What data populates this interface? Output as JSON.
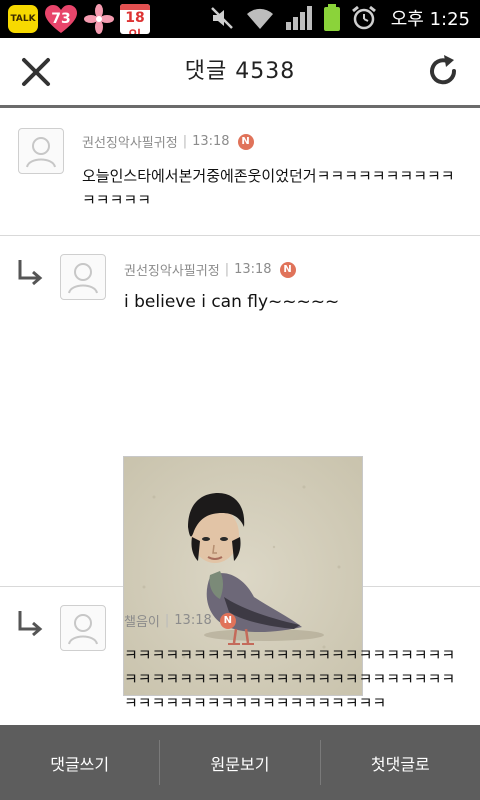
{
  "status_bar": {
    "talk_label": "TALK",
    "notification_count": "73",
    "calendar_day": "18일",
    "time": "오후 1:25",
    "icons": [
      "kakaotalk-icon",
      "heart-notification-icon",
      "flower-icon",
      "calendar-icon",
      "mute-icon",
      "wifi-icon",
      "signal-icon",
      "battery-icon",
      "alarm-icon"
    ]
  },
  "header": {
    "title": "댓글 4538",
    "close_icon": "close-icon",
    "refresh_icon": "refresh-icon"
  },
  "comments": [
    {
      "author": "권선징악사필귀정",
      "time": "13:18",
      "badge": "N",
      "text": "오늘인스타에서본거중에존웃이었던거ㅋㅋㅋㅋㅋㅋㅋㅋㅋㅋㅋㅋㅋㅋㅋ",
      "is_reply": false
    },
    {
      "author": "권선징악사필귀정",
      "time": "13:18",
      "badge": "N",
      "text": "i believe i can fly~~~~~",
      "is_reply": true,
      "has_image": true
    },
    {
      "author": "챌음이",
      "time": "13:18",
      "badge": "N",
      "text": "ㅋㅋㅋㅋㅋㅋㅋㅋㅋㅋㅋㅋㅋㅋㅋㅋㅋㅋㅋㅋㅋㅋㅋㅋㅋㅋㅋㅋㅋㅋㅋㅋㅋㅋㅋㅋㅋㅋㅋㅋㅋㅋㅋㅋㅋㅋㅋㅋㅋㅋㅋㅋㅋㅋㅋㅋㅋㅋㅋㅋㅋㅋㅋㅋㅋㅋㅋ",
      "is_reply": true
    }
  ],
  "bottom_bar": {
    "write_label": "댓글쓰기",
    "original_label": "원문보기",
    "first_label": "첫댓글로"
  },
  "colors": {
    "header_divider": "#6b6b6b",
    "bottom_bar": "#5d5d5d",
    "badge": "#e0735a"
  }
}
